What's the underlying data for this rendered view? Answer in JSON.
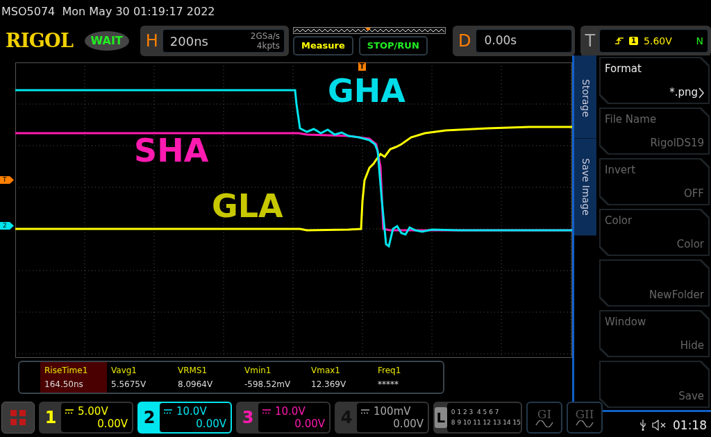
{
  "status_line": "MSO5074  Mon May 30 01:19:17 2022",
  "logo": "RIGOL",
  "run_status": "WAIT",
  "horizontal": {
    "label": "H",
    "timebase": "200ns",
    "sample_rate": "2GSa/s",
    "memory_depth": "4kpts"
  },
  "buttons": [
    {
      "label": "Measure",
      "color": "#ffff00"
    },
    {
      "label": "STOP/RUN",
      "color": "#22ee22"
    }
  ],
  "delay": {
    "label": "D",
    "value": "0.00s"
  },
  "trigger": {
    "label": "T",
    "source": "1",
    "voltage": "5.60V",
    "mode": "N"
  },
  "trigger_position_marker": "T",
  "side_markers": [
    {
      "text": "T",
      "color": "#ff8000"
    },
    {
      "text": "2",
      "color": "#00e5ee"
    }
  ],
  "trace_labels": [
    {
      "text": "GHA",
      "color": "#00dde8"
    },
    {
      "text": "SHA",
      "color": "#ff1ab0"
    },
    {
      "text": "GLA",
      "color": "#c8c800"
    }
  ],
  "menu": {
    "tabs": [
      {
        "label": "Storage"
      },
      {
        "label": "Save Image"
      }
    ],
    "items": [
      {
        "title": "Format",
        "value": "*.png",
        "disabled": false,
        "submenu": true
      },
      {
        "title": "File Name",
        "value": "RigolDS19",
        "disabled": true,
        "submenu": false
      },
      {
        "title": "Invert",
        "value": "OFF",
        "disabled": true,
        "submenu": false
      },
      {
        "title": "Color",
        "value": "Color",
        "disabled": true,
        "submenu": false
      },
      {
        "value": "NewFolder",
        "disabled": true,
        "submenu": false
      },
      {
        "title": "Window",
        "value": "Hide",
        "disabled": true,
        "submenu": false
      },
      {
        "value": "Save",
        "disabled": true,
        "submenu": false
      }
    ]
  },
  "measurements": [
    {
      "name": "RiseTime1",
      "value": "164.50ns",
      "selected": true
    },
    {
      "name": "Vavg1",
      "value": "5.5675V",
      "selected": false
    },
    {
      "name": "VRMS1",
      "value": "8.0964V",
      "selected": false
    },
    {
      "name": "Vmin1",
      "value": "-598.52mV",
      "selected": false
    },
    {
      "name": "Vmax1",
      "value": "12.369V",
      "selected": false
    },
    {
      "name": "Freq1",
      "value": "*****",
      "selected": false
    }
  ],
  "channels": [
    {
      "number": "1",
      "scale": "5.00V",
      "offset": "0.00V",
      "color": "#ffff00",
      "selected": false
    },
    {
      "number": "2",
      "scale": "10.0V",
      "offset": "0.00V",
      "color": "#00e5ee",
      "selected": true
    },
    {
      "number": "3",
      "scale": "10.0V",
      "offset": "0.00V",
      "color": "#ff1ab0",
      "selected": false
    },
    {
      "number": "4",
      "scale": "100mV",
      "offset": "0.00V",
      "color": "#a8a8a8",
      "selected": false
    }
  ],
  "logic": {
    "label": "L",
    "rows": [
      "0 1 2 3  4 5 6 7",
      "8 9 10 11 12 13 14 15"
    ]
  },
  "generators": [
    {
      "label": "GI"
    },
    {
      "label": "GII"
    }
  ],
  "clock": "01:18"
}
